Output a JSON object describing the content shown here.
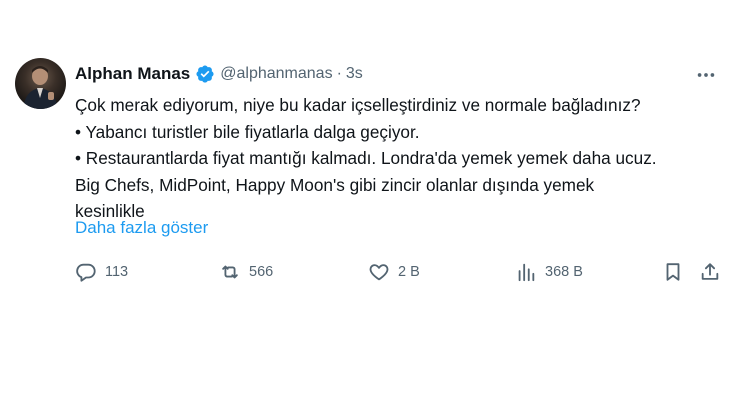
{
  "author": {
    "name": "Alphan Manas",
    "handle": "@alphanmanas",
    "separator": "·",
    "time": "3s"
  },
  "tweet": {
    "lines": [
      "Çok merak ediyorum, niye bu kadar içselleştirdiniz ve normale bağladınız?",
      "• Yabancı turistler bile fiyatlarla dalga geçiyor.",
      "• Restaurantlarda fiyat mantığı kalmadı. Londra'da yemek yemek daha ucuz.",
      "Big Chefs, MidPoint, Happy Moon's gibi zincir olanlar dışında yemek",
      "kesinlikle"
    ],
    "show_more": "Daha fazla göster"
  },
  "actions": {
    "replies": "113",
    "retweets": "566",
    "likes": "2 B",
    "views": "368 B"
  },
  "colors": {
    "accent": "#1d9bf0",
    "muted": "#536471",
    "text": "#0f1419",
    "retweet_accent": "#00ba7c"
  },
  "icons": {
    "verified": "verified-badge-icon",
    "more": "more-horizontal-icon",
    "reply": "reply-bubble-icon",
    "retweet": "retweet-icon",
    "like": "heart-icon",
    "views": "views-bar-chart-icon",
    "bookmark": "bookmark-icon",
    "share": "share-upload-icon"
  }
}
